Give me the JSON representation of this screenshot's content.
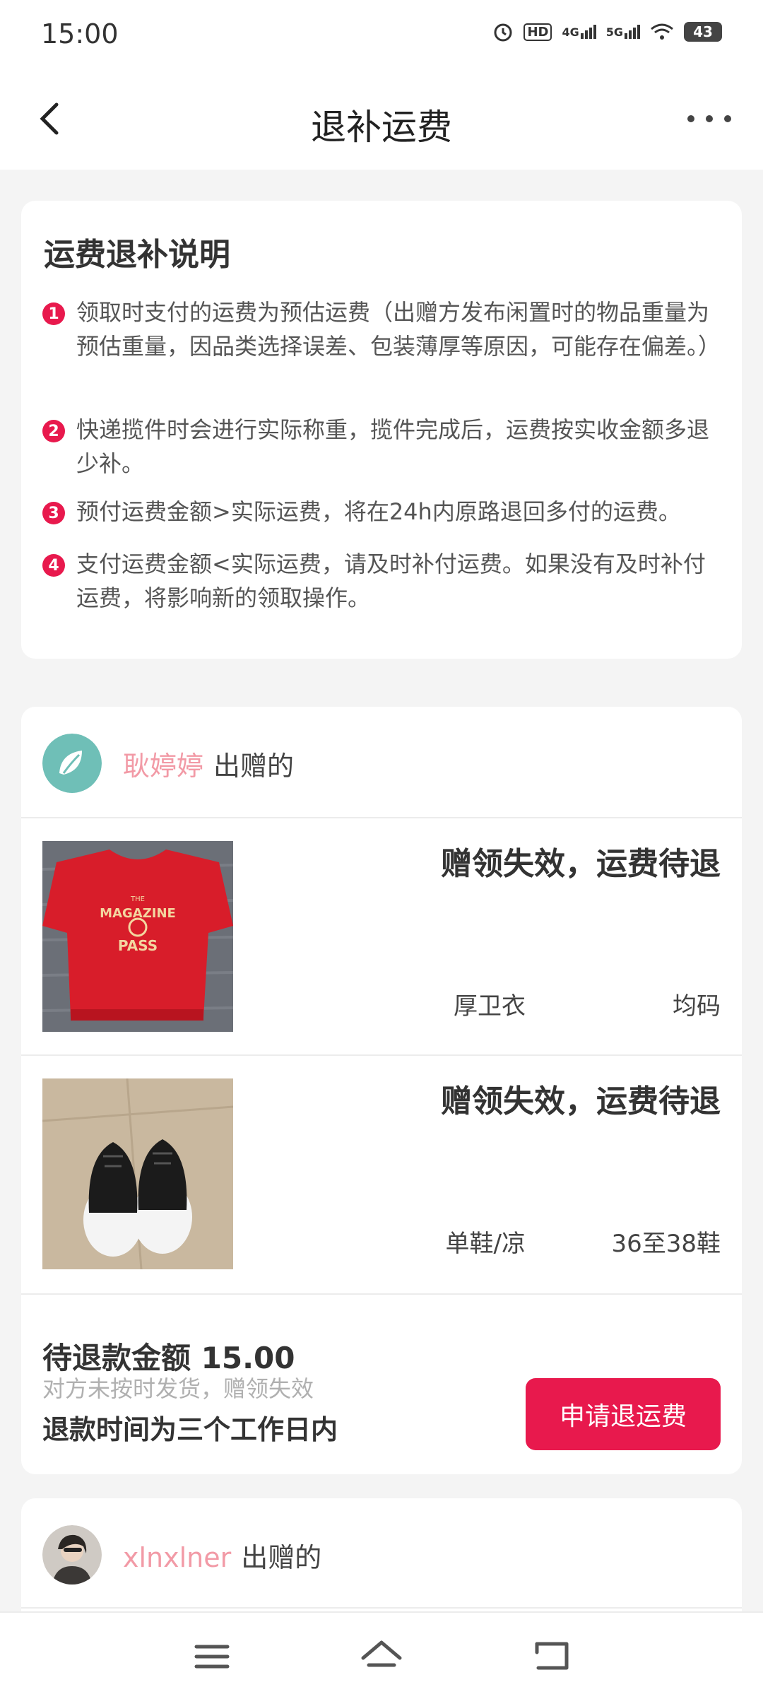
{
  "status_bar": {
    "time": "15:00",
    "icons": [
      "alarm-icon",
      "hd-icon",
      "4g-signal-icon",
      "5g-signal-icon",
      "wifi-icon"
    ],
    "net1": "HD",
    "net2": "4G",
    "net3": "5G",
    "battery": "43"
  },
  "header": {
    "title": "退补运费",
    "back_icon": "chevron-left-icon",
    "more_icon": "more-dots-icon"
  },
  "notice": {
    "title": "运费退补说明",
    "items": [
      {
        "num": "1",
        "text": "领取时支付的运费为预估运费（出赠方发布闲置时的物品重量为预估重量，因品类选择误差、包装薄厚等原因，可能存在偏差。）"
      },
      {
        "num": "2",
        "text": "快递揽件时会进行实际称重，揽件完成后，运费按实收金额多退少补。"
      },
      {
        "num": "3",
        "text": "预付运费金额>实际运费，将在24h内原路退回多付的运费。"
      },
      {
        "num": "4",
        "text": "支付运费金额<实际运费，请及时补付运费。如果没有及时补付运费，将影响新的领取操作。"
      }
    ]
  },
  "orders": [
    {
      "donor_name": "耿婷婷",
      "donor_suffix": "出赠的",
      "items": [
        {
          "status": "赠领失效，运费待退",
          "category": "厚卫衣",
          "size": "均码",
          "image": "red-sweatshirt"
        },
        {
          "status": "赠领失效，运费待退",
          "category": "单鞋/凉",
          "size": "36至38鞋",
          "image": "black-sneakers"
        }
      ],
      "refund_amount": "待退款金额 15.00",
      "refund_reason": "对方未按时发货，赠领失效",
      "refund_time": "退款时间为三个工作日内",
      "refund_button": "申请退运费"
    },
    {
      "donor_name": "xlnxlner",
      "donor_suffix": "出赠的"
    }
  ],
  "colors": {
    "accent": "#e8194d",
    "donor_name": "#f29aa6",
    "background": "#f4f4f4"
  },
  "bottom_nav": {
    "icons": [
      "menu-icon",
      "home-icon",
      "back-return-icon"
    ]
  }
}
